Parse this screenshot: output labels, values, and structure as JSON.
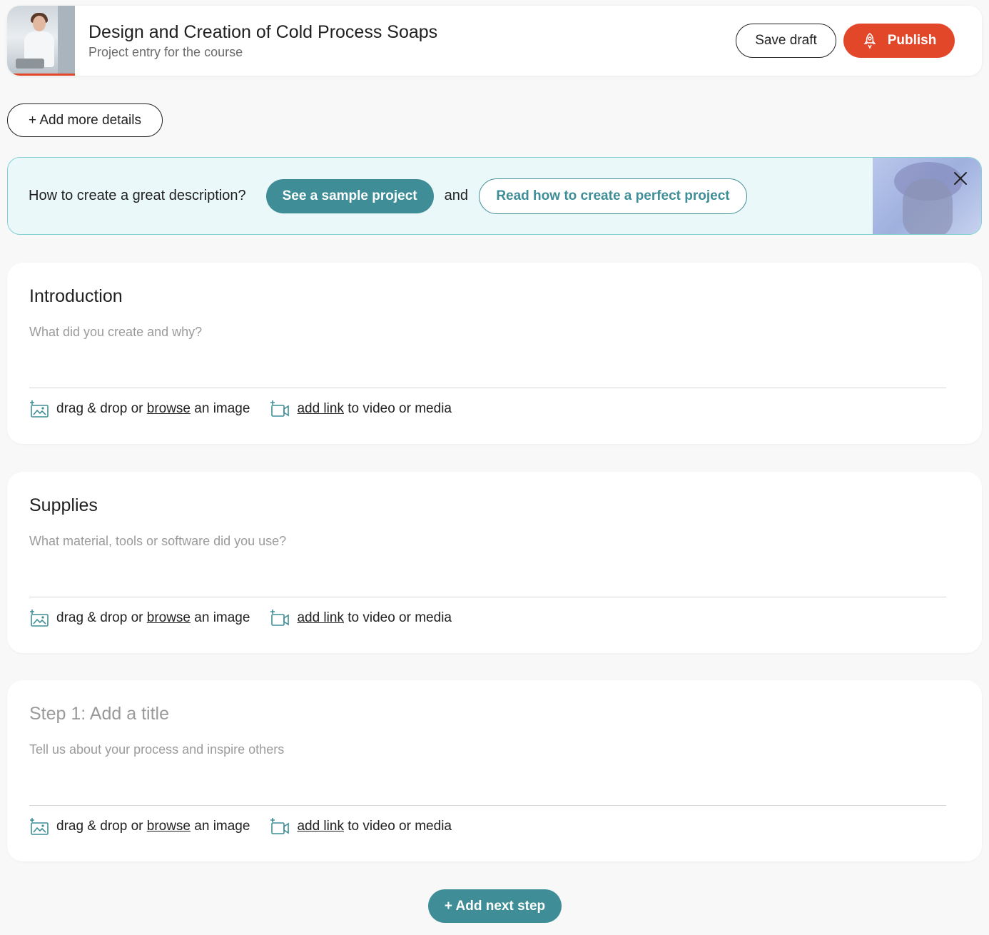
{
  "header": {
    "title": "Design and Creation of Cold Process Soaps",
    "subtitle": "Project entry for the course",
    "save_label": "Save draft",
    "publish_label": "Publish"
  },
  "add_details_label": "+ Add more details",
  "tip": {
    "question": "How to create a great description?",
    "sample_label": "See a sample project",
    "and_text": "and",
    "read_label": "Read how to create a perfect project"
  },
  "media_bar": {
    "drag_text": "drag & drop or",
    "browse_link": "browse",
    "image_text": "an image",
    "add_link": "add link",
    "video_text": "to video or media"
  },
  "sections": [
    {
      "title": "Introduction",
      "placeholder": "What did you create and why?"
    },
    {
      "title": "Supplies",
      "placeholder": "What material, tools or software did you use?"
    },
    {
      "title": "Step 1: Add a title",
      "placeholder": "Tell us about your process and inspire others"
    }
  ],
  "add_step_label": "+ Add next step",
  "colors": {
    "accent_teal": "#3f8e97",
    "publish_red": "#e2472a",
    "tip_bg": "#ebf8f9"
  }
}
